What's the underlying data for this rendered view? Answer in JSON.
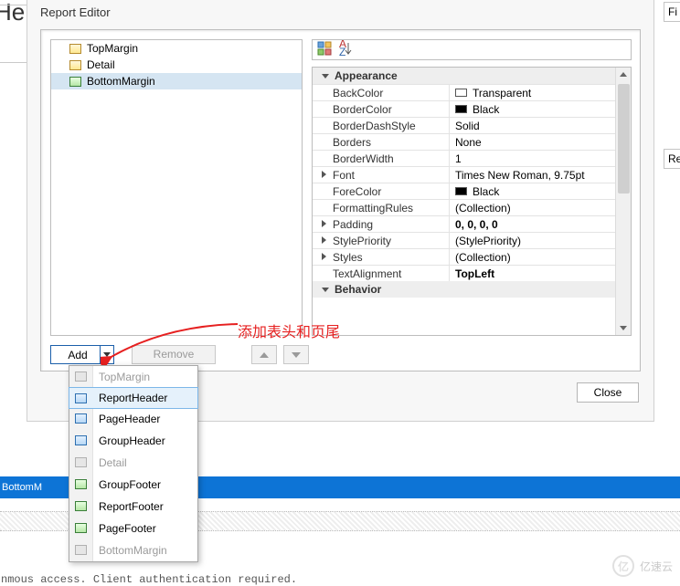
{
  "dialog": {
    "title": "Report Editor"
  },
  "side": {
    "fi": "Fi",
    "re": "Re"
  },
  "he": "He",
  "tree": {
    "items": [
      {
        "label": "TopMargin"
      },
      {
        "label": "Detail"
      },
      {
        "label": "BottomMargin"
      }
    ]
  },
  "buttons": {
    "add": "Add",
    "remove": "Remove",
    "close": "Close"
  },
  "props": {
    "cat1": "Appearance",
    "cat2": "Behavior",
    "rows": {
      "BackColor": {
        "k": "BackColor",
        "v": "Transparent",
        "swatch": "#ffffff"
      },
      "BorderColor": {
        "k": "BorderColor",
        "v": "Black",
        "swatch": "#000000"
      },
      "BorderDashStyle": {
        "k": "BorderDashStyle",
        "v": "Solid"
      },
      "Borders": {
        "k": "Borders",
        "v": "None"
      },
      "BorderWidth": {
        "k": "BorderWidth",
        "v": "1"
      },
      "Font": {
        "k": "Font",
        "v": "Times New Roman, 9.75pt"
      },
      "ForeColor": {
        "k": "ForeColor",
        "v": "Black",
        "swatch": "#000000"
      },
      "FormattingRules": {
        "k": "FormattingRules",
        "v": "(Collection)"
      },
      "Padding": {
        "k": "Padding",
        "v": "0, 0, 0, 0",
        "bold": true
      },
      "StylePriority": {
        "k": "StylePriority",
        "v": "(StylePriority)"
      },
      "Styles": {
        "k": "Styles",
        "v": "(Collection)"
      },
      "TextAlignment": {
        "k": "TextAlignment",
        "v": "TopLeft",
        "bold": true
      }
    }
  },
  "dropdown": {
    "items": [
      {
        "label": "TopMargin",
        "disabled": true
      },
      {
        "label": "ReportHeader",
        "selected": true,
        "icon": "blue"
      },
      {
        "label": "PageHeader",
        "icon": "blue"
      },
      {
        "label": "GroupHeader",
        "icon": "blue"
      },
      {
        "label": "Detail",
        "disabled": true
      },
      {
        "label": "GroupFooter",
        "icon": "green"
      },
      {
        "label": "ReportFooter",
        "icon": "green"
      },
      {
        "label": "PageFooter",
        "icon": "green"
      },
      {
        "label": "BottomMargin",
        "disabled": true
      }
    ]
  },
  "annotation": "添加表头和页尾",
  "bluebar": "BottomM",
  "bottomtext": "nmous access. Client authentication required.",
  "watermark": {
    "icon": "亿",
    "text": "亿速云"
  }
}
